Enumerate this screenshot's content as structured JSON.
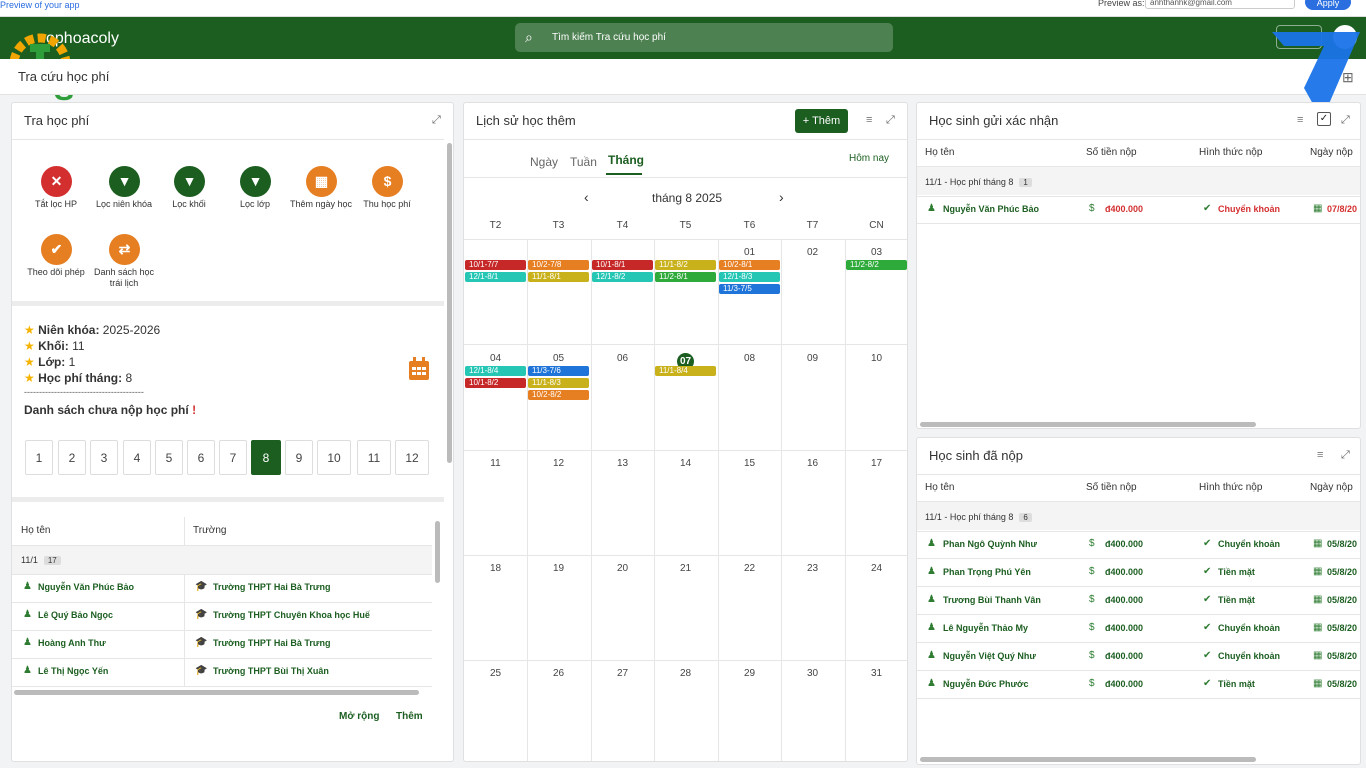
{
  "preview": {
    "text": "Preview of your app",
    "as_label": "Preview as:",
    "email": "anhthanhk@gmail.com",
    "apply": "Apply"
  },
  "app": {
    "name": "ophoacoly",
    "search_placeholder": "Tìm kiếm Tra cứu học phí"
  },
  "page": {
    "title": "Tra cứu học phí"
  },
  "left": {
    "title": "Tra học phí",
    "actions": [
      {
        "label": "Tắt lọc HP",
        "color": "#d32f2f",
        "icon": "✕"
      },
      {
        "label": "Lọc niên khóa",
        "color": "#1b5e20",
        "icon": "▼"
      },
      {
        "label": "Lọc khối",
        "color": "#1b5e20",
        "icon": "▼"
      },
      {
        "label": "Lọc lớp",
        "color": "#1b5e20",
        "icon": "▼"
      },
      {
        "label": "Thêm ngày học",
        "color": "#e67e22",
        "icon": "▦"
      },
      {
        "label": "Thu học phí",
        "color": "#e67e22",
        "icon": "$"
      },
      {
        "label": "Theo dõi phép",
        "color": "#e67e22",
        "icon": "✔"
      },
      {
        "label": "Danh sách học trái lịch",
        "color": "#e67e22",
        "icon": "⇄"
      }
    ],
    "info": {
      "nien_khoa_label": "Niên khóa:",
      "nien_khoa": "2025-2026",
      "khoi_label": "Khối:",
      "khoi": "11",
      "lop_label": "Lớp:",
      "lop": "1",
      "hp_label": "Học phí tháng:",
      "hp": "8",
      "divider": "----------------------------------------",
      "unpaid_title": "Danh sách chưa nộp học phí",
      "exclaim": "!"
    },
    "months": [
      "1",
      "2",
      "3",
      "4",
      "5",
      "6",
      "7",
      "8",
      "9",
      "10",
      "11",
      "12"
    ],
    "active_month": "8",
    "table": {
      "col_name": "Họ tên",
      "col_school": "Trường",
      "group": "11/1",
      "group_count": "17",
      "rows": [
        {
          "name": "Nguyễn Văn Phúc Bảo",
          "school": "Trường THPT Hai Bà Trưng"
        },
        {
          "name": "Lê Quý Bảo Ngọc",
          "school": "Trường THPT Chuyên Khoa học Huế"
        },
        {
          "name": "Hoàng Anh Thư",
          "school": "Trường THPT Hai Bà Trưng"
        },
        {
          "name": "Lê Thị Ngọc Yến",
          "school": "Trường THPT Bùi Thị Xuân"
        }
      ]
    },
    "more": "Mở rộng",
    "add": "Thêm"
  },
  "calendar": {
    "title": "Lịch sử học thêm",
    "add": "Thêm",
    "tabs": [
      "Ngày",
      "Tuần",
      "Tháng"
    ],
    "today_btn": "Hôm nay",
    "month_label": "tháng 8 2025",
    "weekdays": [
      "T2",
      "T3",
      "T4",
      "T5",
      "T6",
      "T7",
      "CN"
    ],
    "weeks": [
      [
        "",
        "",
        "",
        "",
        "01",
        "02",
        "03"
      ],
      [
        "04",
        "05",
        "06",
        "07",
        "08",
        "09",
        "10"
      ],
      [
        "11",
        "12",
        "13",
        "14",
        "15",
        "16",
        "17"
      ],
      [
        "18",
        "19",
        "20",
        "21",
        "22",
        "23",
        "24"
      ],
      [
        "25",
        "26",
        "27",
        "28",
        "29",
        "30",
        "31"
      ]
    ],
    "events": [
      {
        "w": 0,
        "d": 0,
        "slot": 0,
        "text": "10/1-7/7",
        "color": "#c62828"
      },
      {
        "w": 0,
        "d": 0,
        "slot": 1,
        "text": "12/1-8/1",
        "color": "#26c6b5"
      },
      {
        "w": 0,
        "d": 1,
        "slot": 0,
        "text": "10/2-7/8",
        "color": "#e67e22"
      },
      {
        "w": 0,
        "d": 1,
        "slot": 1,
        "text": "11/1-8/1",
        "color": "#c9b11b"
      },
      {
        "w": 0,
        "d": 2,
        "slot": 0,
        "text": "10/1-8/1",
        "color": "#c62828"
      },
      {
        "w": 0,
        "d": 2,
        "slot": 1,
        "text": "12/1-8/2",
        "color": "#26c6b5"
      },
      {
        "w": 0,
        "d": 3,
        "slot": 0,
        "text": "11/1-8/2",
        "color": "#c9b11b"
      },
      {
        "w": 0,
        "d": 3,
        "slot": 1,
        "text": "11/2-8/1",
        "color": "#2eaa3a"
      },
      {
        "w": 0,
        "d": 4,
        "slot": 0,
        "text": "10/2-8/1",
        "color": "#e67e22"
      },
      {
        "w": 0,
        "d": 4,
        "slot": 1,
        "text": "12/1-8/3",
        "color": "#26c6b5"
      },
      {
        "w": 0,
        "d": 4,
        "slot": 2,
        "text": "11/3-7/5",
        "color": "#1e74d8"
      },
      {
        "w": 0,
        "d": 6,
        "slot": 0,
        "text": "11/2-8/2",
        "color": "#2eaa3a"
      },
      {
        "w": 1,
        "d": 0,
        "slot": 0,
        "text": "12/1-8/4",
        "color": "#26c6b5"
      },
      {
        "w": 1,
        "d": 0,
        "slot": 1,
        "text": "10/1-8/2",
        "color": "#c62828"
      },
      {
        "w": 1,
        "d": 1,
        "slot": 0,
        "text": "11/3-7/6",
        "color": "#1e74d8"
      },
      {
        "w": 1,
        "d": 1,
        "slot": 1,
        "text": "11/1-8/3",
        "color": "#c9b11b"
      },
      {
        "w": 1,
        "d": 1,
        "slot": 2,
        "text": "10/2-8/2",
        "color": "#e67e22"
      },
      {
        "w": 1,
        "d": 3,
        "slot": 0,
        "text": "11/1-8/4",
        "color": "#c9b11b"
      }
    ],
    "today": "07"
  },
  "confirm": {
    "title": "Học sinh gửi xác nhận",
    "cols": [
      "Họ tên",
      "Số tiền nộp",
      "Hình thức nộp",
      "Ngày nộp"
    ],
    "group": "11/1 - Học phí tháng 8",
    "group_count": "1",
    "rows": [
      {
        "name": "Nguyễn Văn Phúc Bảo",
        "amount": "đ400.000",
        "method": "Chuyển khoản",
        "date": "07/8/20"
      }
    ]
  },
  "paid": {
    "title": "Học sinh đã nộp",
    "cols": [
      "Họ tên",
      "Số tiền nộp",
      "Hình thức nộp",
      "Ngày nộp"
    ],
    "group": "11/1 - Học phí tháng 8",
    "group_count": "6",
    "rows": [
      {
        "name": "Phan Ngô Quỳnh Như",
        "amount": "đ400.000",
        "method": "Chuyển khoản",
        "date": "05/8/20"
      },
      {
        "name": "Phan Trọng Phú Yên",
        "amount": "đ400.000",
        "method": "Tiền mặt",
        "date": "05/8/20"
      },
      {
        "name": "Trương Bùi Thanh Vân",
        "amount": "đ400.000",
        "method": "Tiền mặt",
        "date": "05/8/20"
      },
      {
        "name": "Lê Nguyễn Thảo My",
        "amount": "đ400.000",
        "method": "Chuyển khoản",
        "date": "05/8/20"
      },
      {
        "name": "Nguyễn Việt Quý Như",
        "amount": "đ400.000",
        "method": "Chuyển khoản",
        "date": "05/8/20"
      },
      {
        "name": "Nguyễn Đức Phước",
        "amount": "đ400.000",
        "method": "Tiền mặt",
        "date": "05/8/20"
      }
    ]
  }
}
